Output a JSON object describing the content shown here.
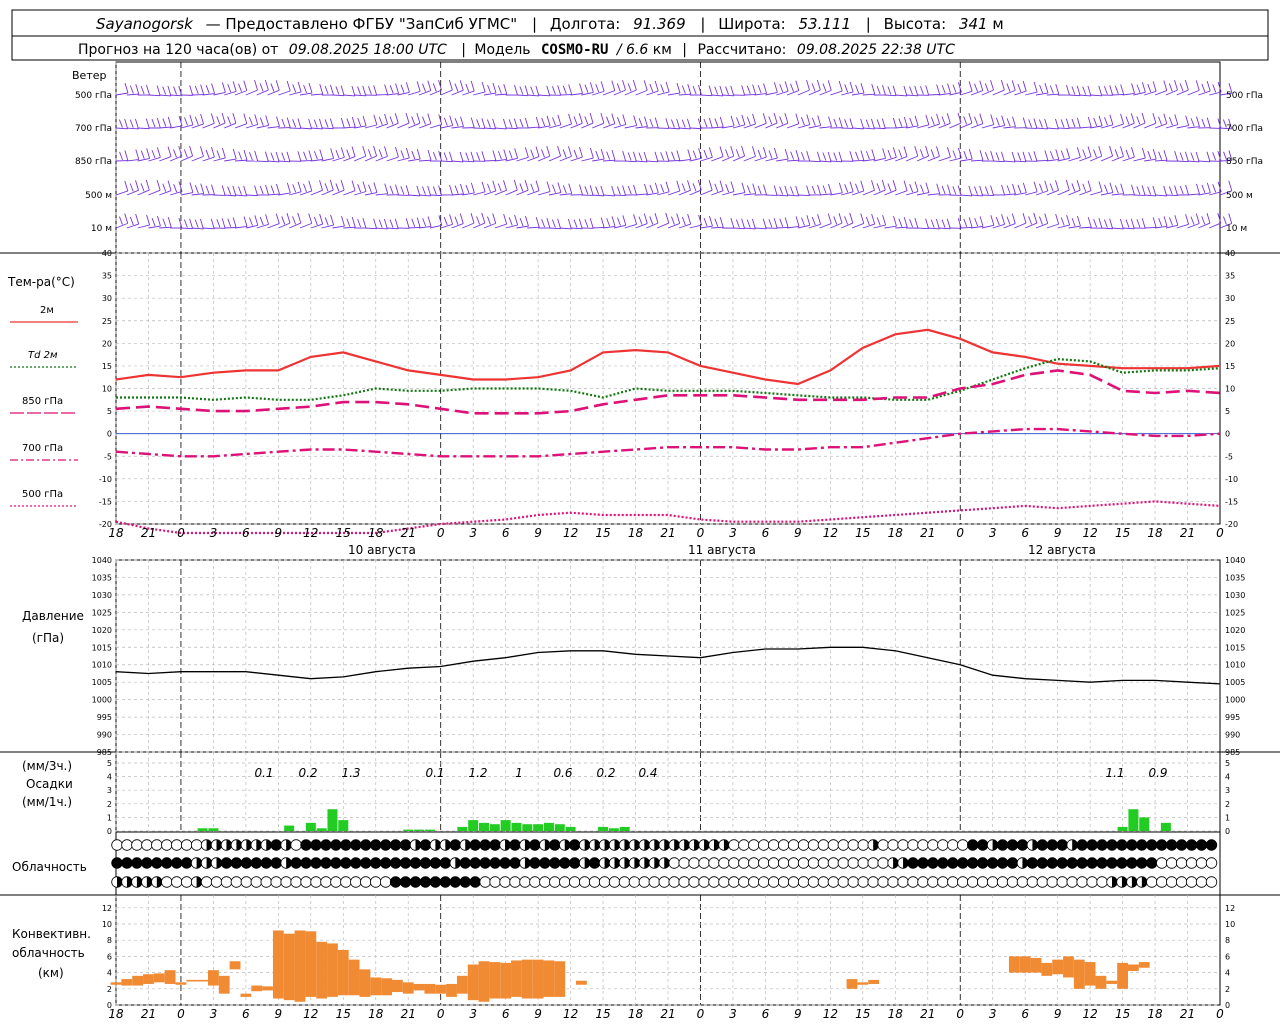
{
  "header": {
    "station": "Sayanogorsk",
    "provider": "— Предоставлено ФГБУ \"ЗапСиб УГМС\"",
    "lon_label": "Долгота:",
    "lon_value": "91.369",
    "lat_label": "Широта:",
    "lat_value": "53.111",
    "alt_label": "Высота:",
    "alt_value": "341",
    "alt_unit": "м",
    "forecast_label": "Прогноз на 120 часа(ов) от",
    "forecast_time": "09.08.2025 18:00 UTC",
    "model_label": "Модель",
    "model_name": "COSMO-RU",
    "model_res": "/ 6.6",
    "model_res_unit": "км",
    "calc_label": "Рассчитано:",
    "calc_time": "09.08.2025 22:38 UTC"
  },
  "time_axis": {
    "hour_labels": [
      "18",
      "21",
      "0",
      "3",
      "6",
      "9",
      "12",
      "15",
      "18",
      "21",
      "0",
      "3",
      "6",
      "9",
      "12",
      "15",
      "18",
      "21",
      "0",
      "3",
      "6",
      "9",
      "12",
      "15",
      "18",
      "21",
      "0",
      "3",
      "6",
      "9",
      "12",
      "15",
      "18",
      "21",
      "0"
    ],
    "day_labels": [
      "10 августа",
      "11 августа",
      "12 августа"
    ]
  },
  "wind_panel": {
    "title": "Ветер",
    "levels": [
      "500 гПа",
      "700 гПа",
      "850 гПа",
      "500 м",
      "10 м"
    ],
    "color": "#7733dd"
  },
  "temp_panel": {
    "title": "Тем-ра(°C)",
    "ymin": -20,
    "ymax": 40,
    "ticks": [
      "-20",
      "-15",
      "-10",
      "-5",
      "0",
      "5",
      "10",
      "15",
      "20",
      "25",
      "30",
      "35",
      "40"
    ],
    "legend": [
      {
        "name": "2м",
        "color": "#ee3333",
        "style": "solid"
      },
      {
        "name": "Td 2м",
        "color": "#117711",
        "style": "dotted"
      },
      {
        "name": "850 гПа",
        "color": "#dd1177",
        "style": "dash"
      },
      {
        "name": "700 гПа",
        "color": "#dd1177",
        "style": "dashdot"
      },
      {
        "name": "500 гПа",
        "color": "#dd1177",
        "style": "dot"
      }
    ]
  },
  "pressure_panel": {
    "title1": "Давление",
    "title2": "(гПа)",
    "ticks": [
      "985",
      "990",
      "995",
      "1000",
      "1005",
      "1010",
      "1015",
      "1020",
      "1025",
      "1030",
      "1035",
      "1040"
    ]
  },
  "precip_panel": {
    "title1": "(мм/3ч.)",
    "title2": "Осадки",
    "title3": "(мм/1ч.)",
    "ticks": [
      "0",
      "1",
      "2",
      "3",
      "4",
      "5"
    ],
    "totals": [
      "0.1",
      "0.2",
      "1.3",
      "0.1",
      "1.2",
      "1",
      "0.6",
      "0.2",
      "0.4",
      "1.1",
      "0.9"
    ],
    "color": "#22cc22"
  },
  "cloud_panel": {
    "title": "Облачность"
  },
  "convective_panel": {
    "title1": "Конвективн.",
    "title2": "облачность",
    "title3": "(км)",
    "ticks": [
      "0",
      "2",
      "4",
      "6",
      "8",
      "10",
      "12"
    ],
    "color": "#f08a33"
  },
  "chart_data": {
    "type": "line",
    "x_hours_from_start": [
      0,
      3,
      6,
      9,
      12,
      15,
      18,
      21,
      24,
      27,
      30,
      33,
      36,
      39,
      42,
      45,
      48,
      51,
      54,
      57,
      60,
      63,
      66,
      69,
      72,
      75,
      78,
      81,
      84,
      87,
      90,
      93,
      96,
      99,
      102
    ],
    "series": [
      {
        "name": "2м",
        "values": [
          12,
          13,
          12.5,
          13.5,
          14,
          14,
          17,
          18,
          16,
          14,
          13,
          12,
          12,
          12.5,
          14,
          18,
          18.5,
          18,
          15,
          13.5,
          12,
          11,
          14,
          19,
          22,
          23,
          21,
          18,
          17,
          15.5,
          15,
          14.5,
          14.5,
          14.5,
          15
        ]
      },
      {
        "name": "Td 2м",
        "values": [
          8,
          8,
          8,
          7.5,
          8,
          7.5,
          7.5,
          8.5,
          10,
          9.5,
          9.5,
          10,
          10,
          10,
          9.5,
          8,
          10,
          9.5,
          9.5,
          9.5,
          9,
          8.5,
          8,
          8,
          7.5,
          7.5,
          9.5,
          12,
          14.5,
          16.5,
          16,
          13.5,
          14,
          14,
          14.5
        ]
      },
      {
        "name": "850 гПа",
        "values": [
          5.5,
          6,
          5.5,
          5,
          5,
          5.5,
          6,
          7,
          7,
          6.5,
          5.5,
          4.5,
          4.5,
          4.5,
          5,
          6.5,
          7.5,
          8.5,
          8.5,
          8.5,
          8,
          7.5,
          7.5,
          7.5,
          8,
          8,
          10,
          11,
          13,
          14,
          13,
          9.5,
          9,
          9.5,
          9
        ]
      },
      {
        "name": "700 гПа",
        "values": [
          -4,
          -4.5,
          -5,
          -5,
          -4.5,
          -4,
          -3.5,
          -3.5,
          -4,
          -4.5,
          -5,
          -5,
          -5,
          -5,
          -4.5,
          -4,
          -3.5,
          -3,
          -3,
          -3,
          -3.5,
          -3.5,
          -3,
          -3,
          -2,
          -1,
          0,
          0.5,
          1,
          1,
          0.5,
          0,
          -0.5,
          -0.5,
          0
        ]
      },
      {
        "name": "500 гПа",
        "values": [
          -19.5,
          -21,
          -22,
          -22,
          -22,
          -22,
          -22,
          -22,
          -22,
          -21,
          -20,
          -19.5,
          -19,
          -18,
          -17.5,
          -18,
          -18,
          -18,
          -19,
          -19.5,
          -19.5,
          -19.5,
          -19,
          -18.5,
          -18,
          -17.5,
          -17,
          -16.5,
          -16,
          -16.5,
          -16,
          -15.5,
          -15,
          -15.5,
          -16
        ]
      },
      {
        "name": "Давление",
        "values": [
          1008,
          1007.5,
          1008,
          1008,
          1008,
          1007,
          1006,
          1006.5,
          1008,
          1009,
          1009.5,
          1011,
          1012,
          1013.5,
          1014,
          1014,
          1013,
          1012.5,
          1012,
          1013.5,
          1014.5,
          1014.5,
          1015,
          1015,
          1014,
          1012,
          1010,
          1007,
          1006,
          1005.5,
          1005,
          1005.5,
          1005.5,
          1005,
          1004.5
        ]
      }
    ],
    "precip_3h_labels_hours": [
      9,
      12,
      15,
      21,
      24,
      27,
      30,
      33,
      36,
      45,
      48
    ],
    "precip_1h_bars": [
      [
        8,
        0.2
      ],
      [
        9,
        0.2
      ],
      [
        16,
        0.4
      ],
      [
        18,
        0.6
      ],
      [
        19,
        0.2
      ],
      [
        20,
        1.6
      ],
      [
        21,
        0.8
      ],
      [
        27,
        0.1
      ],
      [
        28,
        0.1
      ],
      [
        29,
        0.1
      ],
      [
        32,
        0.3
      ],
      [
        33,
        0.8
      ],
      [
        34,
        0.6
      ],
      [
        35,
        0.5
      ],
      [
        36,
        0.8
      ],
      [
        37,
        0.6
      ],
      [
        38,
        0.5
      ],
      [
        39,
        0.5
      ],
      [
        40,
        0.6
      ],
      [
        41,
        0.5
      ],
      [
        42,
        0.3
      ],
      [
        45,
        0.3
      ],
      [
        46,
        0.2
      ],
      [
        47,
        0.3
      ],
      [
        93,
        0.3
      ],
      [
        94,
        1.6
      ],
      [
        95,
        1.0
      ],
      [
        97,
        0.6
      ]
    ],
    "convective_bars_km": [
      [
        0,
        2.5,
        2.8
      ],
      [
        1,
        2.4,
        3.2
      ],
      [
        2,
        2.4,
        3.6
      ],
      [
        3,
        2.6,
        3.8
      ],
      [
        4,
        2.8,
        3.9
      ],
      [
        5,
        2.6,
        4.3
      ],
      [
        6,
        2.5,
        2.8
      ],
      [
        7,
        2.9,
        3.1
      ],
      [
        8,
        2.9,
        3.1
      ],
      [
        9,
        2.4,
        4.3
      ],
      [
        10,
        1.4,
        3.6
      ],
      [
        11,
        4.4,
        5.4
      ],
      [
        12,
        1.0,
        1.4
      ],
      [
        13,
        1.7,
        2.4
      ],
      [
        14,
        1.8,
        2.3
      ],
      [
        15,
        0.8,
        9.2
      ],
      [
        16,
        0.6,
        8.8
      ],
      [
        17,
        0.4,
        9.2
      ],
      [
        18,
        1.0,
        9.1
      ],
      [
        19,
        0.8,
        7.8
      ],
      [
        20,
        1.0,
        7.6
      ],
      [
        21,
        1.2,
        6.8
      ],
      [
        22,
        1.2,
        5.6
      ],
      [
        23,
        1.0,
        4.4
      ],
      [
        24,
        1.2,
        3.4
      ],
      [
        25,
        1.2,
        3.3
      ],
      [
        26,
        1.6,
        3.1
      ],
      [
        27,
        1.4,
        2.8
      ],
      [
        28,
        1.8,
        2.6
      ],
      [
        29,
        1.4,
        2.6
      ],
      [
        30,
        1.4,
        2.5
      ],
      [
        31,
        1.0,
        2.6
      ],
      [
        32,
        1.4,
        3.6
      ],
      [
        33,
        0.6,
        5.0
      ],
      [
        34,
        0.4,
        5.4
      ],
      [
        35,
        0.8,
        5.3
      ],
      [
        36,
        0.8,
        5.2
      ],
      [
        37,
        1.0,
        5.5
      ],
      [
        38,
        0.8,
        5.6
      ],
      [
        39,
        0.8,
        5.6
      ],
      [
        40,
        1.0,
        5.5
      ],
      [
        41,
        1.0,
        5.4
      ],
      [
        43,
        2.5,
        3.0
      ],
      [
        68,
        2.0,
        3.2
      ],
      [
        69,
        2.5,
        2.8
      ],
      [
        70,
        2.6,
        3.1
      ],
      [
        83,
        4.0,
        6.0
      ],
      [
        84,
        4.0,
        6.0
      ],
      [
        85,
        4.0,
        5.8
      ],
      [
        86,
        3.6,
        5.2
      ],
      [
        87,
        3.8,
        5.6
      ],
      [
        88,
        3.4,
        6.0
      ],
      [
        89,
        2.0,
        5.6
      ],
      [
        90,
        2.4,
        5.3
      ],
      [
        91,
        2.0,
        3.6
      ],
      [
        92,
        2.6,
        3.0
      ],
      [
        93,
        2.0,
        5.2
      ],
      [
        94,
        4.2,
        5.0
      ],
      [
        95,
        4.6,
        5.3
      ]
    ],
    "cloud_rows": [
      "oooooooooHHHHHHHFHoFFFFFFFFFFFHFHHFHFFFHFHFHFHFHHHHHHHHHHHHHHHooooooooooooooHoooooooooFFHFFFHFFFHFFFFFFFFFFFFFFFFFFF",
      "FFFFFFFFHHHFFFFFFHFFFFFFFFFFFFFFFFHFFFFFFHFFFFFHFHHHHHHHooooooooooooooooooooooHHFFFFFFFFFFFHFFFFFFFFFFFFFoooooooo",
      "HHHHHoooHoooooooooooooooooooFFFFFFFFFoooooooooooooooooooooooooooooooooooooooooooooooooooooooooooooooHHHHoooooooooooo"
    ]
  }
}
